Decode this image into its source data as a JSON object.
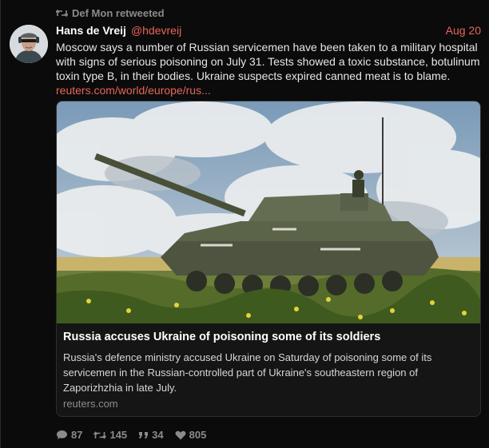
{
  "retweet": {
    "label": "Def Mon retweeted",
    "icon": "retweet-icon"
  },
  "author": {
    "display_name": "Hans de Vreij",
    "handle": "@hdevreij",
    "avatar_icon": "avatar"
  },
  "tweet": {
    "date": "Aug 20",
    "text": "Moscow says a number of Russian servicemen have been taken to a military hospital with signs of serious poisoning on July 31. Tests showed a toxic substance, botulinum toxin type B, in their bodies. Ukraine suspects  expired canned meat is to blame.",
    "link": "reuters.com/world/europe/rus..."
  },
  "card": {
    "title": "Russia accuses Ukraine of poisoning some of its soldiers",
    "description": "Russia's defence ministry accused Ukraine on Saturday of poisoning some of its servicemen in the Russian-controlled part of Ukraine's southeastern region of Zaporizhzhia in late July.",
    "domain": "reuters.com"
  },
  "actions": {
    "replies": "87",
    "retweets": "145",
    "quotes": "34",
    "likes": "805"
  },
  "colors": {
    "accent": "#e8655a",
    "background": "#0b0b0b",
    "muted": "#8b8b8b"
  }
}
